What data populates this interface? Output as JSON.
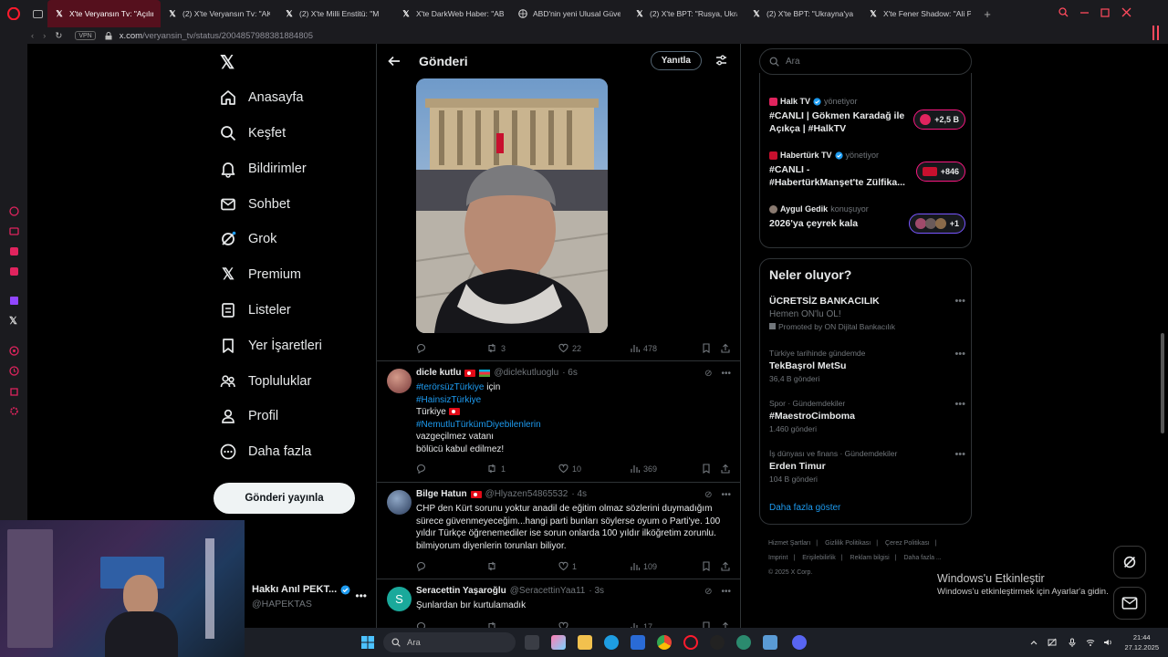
{
  "browser": {
    "tabs": [
      {
        "title": "X'te Veryansın Tv: \"Açılıma",
        "active": true,
        "icon": "x-icon"
      },
      {
        "title": "(2) X'te Veryansın Tv: \"AK",
        "active": false,
        "icon": "x-icon"
      },
      {
        "title": "(2) X'te Milli Enstitü: \"M",
        "active": false,
        "icon": "x-icon"
      },
      {
        "title": "X'te DarkWeb Haber: \"AB",
        "active": false,
        "icon": "x-icon"
      },
      {
        "title": "ABD'nin yeni Ulusal Güven",
        "active": false,
        "icon": "globe-icon"
      },
      {
        "title": "(2) X'te BPT: \"Rusya, Ukra",
        "active": false,
        "icon": "x-icon"
      },
      {
        "title": "(2) X'te BPT: \"Ukrayna'ya",
        "active": false,
        "icon": "x-icon"
      },
      {
        "title": "X'te Fener Shadow: \"Ali Pa",
        "active": false,
        "icon": "x-icon"
      }
    ],
    "vpn_label": "VPN",
    "url_host": "x.com",
    "url_path": "/veryansin_tv/status/2004857988381884805"
  },
  "nav": {
    "items": [
      {
        "label": "Anasayfa",
        "icon": "home-icon"
      },
      {
        "label": "Keşfet",
        "icon": "search-icon"
      },
      {
        "label": "Bildirimler",
        "icon": "bell-icon"
      },
      {
        "label": "Sohbet",
        "icon": "mail-icon"
      },
      {
        "label": "Grok",
        "icon": "grok-icon"
      },
      {
        "label": "Premium",
        "icon": "x-icon"
      },
      {
        "label": "Listeler",
        "icon": "list-icon"
      },
      {
        "label": "Yer İşaretleri",
        "icon": "bookmark-icon"
      },
      {
        "label": "Topluluklar",
        "icon": "people-icon"
      },
      {
        "label": "Profil",
        "icon": "person-icon"
      },
      {
        "label": "Daha fazla",
        "icon": "more-circle-icon"
      }
    ],
    "post_button": "Gönderi yayınla"
  },
  "account": {
    "name": "Hakkı Anıl PEKT...",
    "handle": "@HAPEKTAS"
  },
  "header": {
    "title": "Gönderi",
    "reply_button": "Yanıtla"
  },
  "main_post_actions": {
    "replies": "",
    "reposts": "3",
    "likes": "22",
    "views": "478"
  },
  "tweets": [
    {
      "name": "dicle kutlu",
      "handle": "@diclekutluoglu",
      "time": "· 6s",
      "lines": [
        {
          "text": "#terörsüzTürkiye",
          "suffix": " için",
          "tag": true
        },
        {
          "text": "#HainsizTürkiye",
          "suffix": "",
          "tag": true
        },
        {
          "text": "Türkiye",
          "suffix": "",
          "tag": false,
          "flag": true
        },
        {
          "text": "#NemutluTürkümDiyebilenlerin",
          "suffix": "",
          "tag": true
        },
        {
          "text": "vazgeçilmez vatanı",
          "suffix": "",
          "tag": false
        },
        {
          "text": "bölücü kabul edilmez!",
          "suffix": "",
          "tag": false
        }
      ],
      "replies": "",
      "reposts": "1",
      "likes": "10",
      "views": "369"
    },
    {
      "name": "Bilge Hatun",
      "handle": "@Hlyazen54865532",
      "time": "· 4s",
      "text": "CHP den Kürt sorunu yoktur anadil de eğitim olmaz sözlerini duymadığım sürece güvenmeyeceğim...hangi parti bunları söylerse oyum o Parti'ye. 100 yıldır Türkçe öğrenemediler ise sorun onlarda 100 yıldır ilköğretim zorunlu. bilmiyorum diyenlerin torunları biliyor.",
      "replies": "",
      "reposts": "",
      "likes": "1",
      "views": "109"
    },
    {
      "name": "Seracettin Yaşaroğlu",
      "handle": "@SeracettinYaa11",
      "time": "· 3s",
      "text": "Şunlardan bır kurtulamadık",
      "avatar_letter": "S",
      "views": "17"
    }
  ],
  "right": {
    "search_placeholder": "Ara",
    "live": [
      {
        "source": "Halk TV",
        "role": "yönetiyor",
        "title": "#CANLI | Gökmen Karadağ ile Açıkça | #HalkTV",
        "pill": "+2,5 B"
      },
      {
        "source": "Habertürk TV",
        "role": "yönetiyor",
        "title": "#CANLI - #HabertürkManşet'te Zülfika...",
        "pill": "+846"
      },
      {
        "source": "Aygul Gedik",
        "role": "konuşuyor",
        "title": "2026'ya çeyrek kala",
        "pill": "+1"
      }
    ],
    "trends_title": "Neler oluyor?",
    "trends": [
      {
        "context": "",
        "name": "ÜCRETSİZ BANKACILIK",
        "sub": "Hemen ON'lu OL!",
        "count": "Promoted by ON Dijital Bankacılık",
        "promoted": true
      },
      {
        "context": "Türkiye tarihinde gündemde",
        "name": "TekBaşrol MetSu",
        "count": "36,4 B gönderi"
      },
      {
        "context": "Spor · Gündemdekiler",
        "name": "#MaestroCimboma",
        "count": "1.460 gönderi"
      },
      {
        "context": "İş dünyası ve finans · Gündemdekiler",
        "name": "Erden Timur",
        "count": "104 B gönderi"
      }
    ],
    "show_more": "Daha fazla göster",
    "footer": [
      "Hizmet Şartları",
      "|",
      "Gizlilik Politikası",
      "|",
      "Çerez Politikası",
      "|",
      "Imprint",
      "|",
      "Erişilebilirlik",
      "|",
      "Reklam bilgisi",
      "|",
      "Daha fazla ...",
      "© 2025 X Corp."
    ]
  },
  "windows": {
    "watermark_title": "Windows'u Etkinleştir",
    "watermark_sub": "Windows'u etkinleştirmek için Ayarlar'a gidin.",
    "taskbar_search": "Ara",
    "time": "21:44",
    "date": "27.12.2025"
  }
}
